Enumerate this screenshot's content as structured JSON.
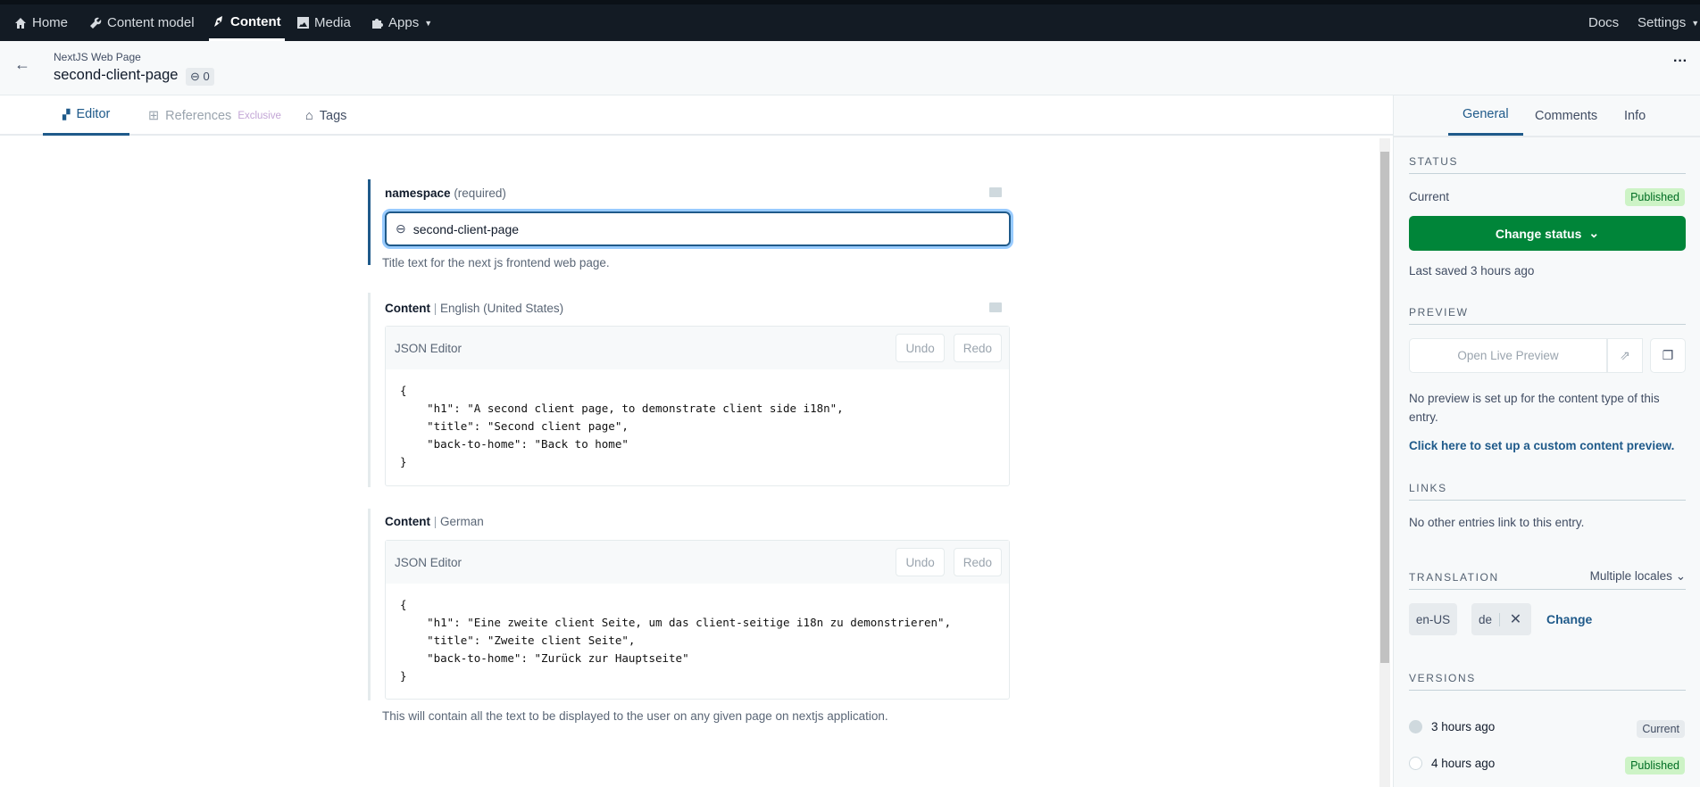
{
  "topnav": {
    "items": [
      {
        "label": "Home",
        "icon": "home-icon"
      },
      {
        "label": "Content model",
        "icon": "wrench-icon"
      },
      {
        "label": "Content",
        "icon": "content-icon",
        "active": true
      },
      {
        "label": "Media",
        "icon": "image-icon"
      },
      {
        "label": "Apps",
        "icon": "puzzle-icon"
      }
    ],
    "docs": "Docs",
    "settings": "Settings"
  },
  "header": {
    "content_type": "NextJS Web Page",
    "title": "second-client-page",
    "links_count": "0"
  },
  "tabs": [
    {
      "label": "Editor"
    },
    {
      "label": "References",
      "suffix": "Exclusive"
    },
    {
      "label": "Tags"
    }
  ],
  "fields": {
    "namespace": {
      "label": "namespace",
      "required": "(required)",
      "value": "second-client-page",
      "help": "Title text for the next js frontend web page."
    },
    "content_en": {
      "label": "Content",
      "locale": "English (United States)",
      "editor_title": "JSON Editor",
      "undo": "Undo",
      "redo": "Redo",
      "code": "{\n    \"h1\": \"A second client page, to demonstrate client side i18n\",\n    \"title\": \"Second client page\",\n    \"back-to-home\": \"Back to home\"\n}"
    },
    "content_de": {
      "label": "Content",
      "locale": "German",
      "editor_title": "JSON Editor",
      "undo": "Undo",
      "redo": "Redo",
      "code": "{\n    \"h1\": \"Eine zweite client Seite, um das client-seitige i18n zu demonstrieren\",\n    \"title\": \"Zweite client Seite\",\n    \"back-to-home\": \"Zurück zur Hauptseite\"\n}",
      "help": "This will contain all the text to be displayed to the user on any given page on nextjs application."
    }
  },
  "sidebar": {
    "tabs": [
      "General",
      "Comments",
      "Info"
    ],
    "status": {
      "heading": "STATUS",
      "current_label": "Current",
      "badge": "Published",
      "button": "Change status",
      "last_saved": "Last saved 3 hours ago"
    },
    "preview": {
      "heading": "PREVIEW",
      "button": "Open Live Preview",
      "note": "No preview is set up for the content type of this entry.",
      "link": "Click here to set up a custom content preview."
    },
    "links": {
      "heading": "LINKS",
      "note": "No other entries link to this entry."
    },
    "translation": {
      "heading": "TRANSLATION",
      "mode": "Multiple locales",
      "locales": [
        "en-US",
        "de"
      ],
      "change": "Change"
    },
    "versions": {
      "heading": "VERSIONS",
      "items": [
        {
          "time": "3 hours ago",
          "badge": "Current"
        },
        {
          "time": "4 hours ago",
          "badge": "Published"
        }
      ]
    }
  },
  "colors": {
    "nav_bg": "#131b24",
    "accent": "#1f5a8a",
    "primary_green": "#008539",
    "link": "#1f5a8a"
  }
}
